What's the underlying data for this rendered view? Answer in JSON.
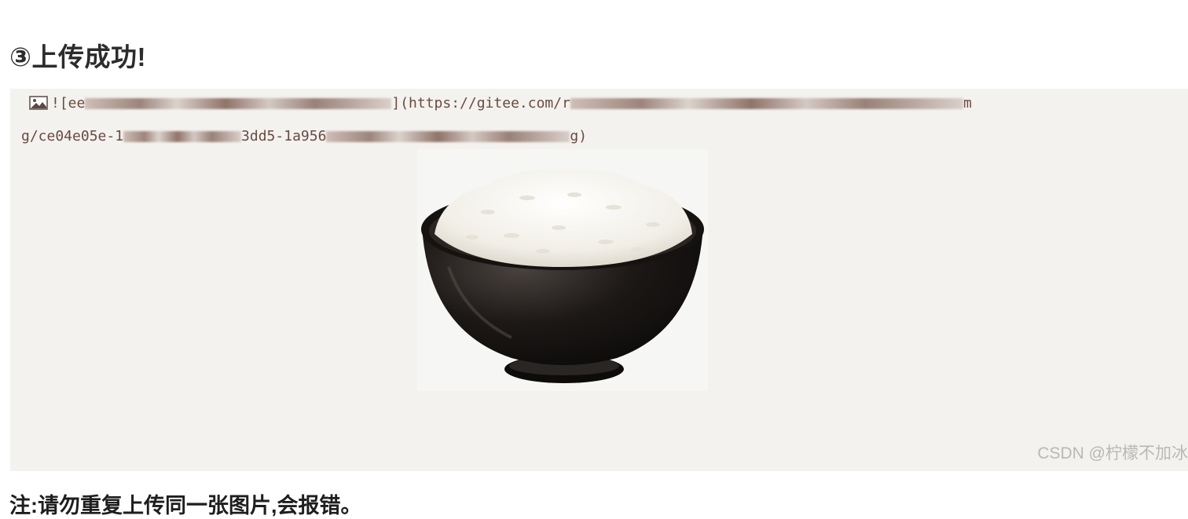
{
  "heading": "③上传成功!",
  "markdown": {
    "line1_prefix": "![ee",
    "line1_mid": "](https://gitee.com/r",
    "line1_end": "m",
    "line2_prefix": "g/ce04e05e-1",
    "line2_mid": "3dd5-1a956",
    "line2_end": "g)"
  },
  "image": {
    "subject": "bowl-of-rice-image",
    "colors": {
      "bowl": "#1a1614",
      "rice": "#f4f2ec",
      "background": "#f6f6f5"
    }
  },
  "watermark": "CSDN @柠檬不加冰",
  "note": "注:请勿重复上传同一张图片,会报错。",
  "colors": {
    "panel": "#f3f2ef",
    "code_text": "#6b4a3f",
    "watermark": "#b8b8b8"
  }
}
